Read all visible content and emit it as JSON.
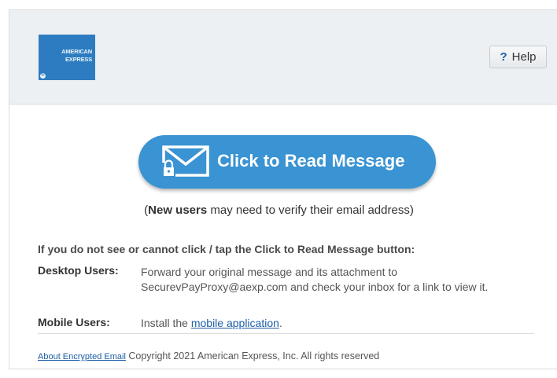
{
  "logo": {
    "line1": "AMERICAN",
    "line2": "EXPRESS",
    "registered": "®"
  },
  "header": {
    "help_icon": "?",
    "help_label": "Help"
  },
  "cta": {
    "label": "Click to Read Message",
    "icon": "envelope-lock-icon",
    "color": "#3a93d2"
  },
  "note": {
    "open": "(",
    "bold": "New users",
    "rest": " may need to verify their email address)"
  },
  "instructions": {
    "title": "If you do not see or cannot click / tap the Click to Read Message button:",
    "desktop_label": "Desktop Users:",
    "desktop_line1": "Forward your original message and its attachment to",
    "desktop_line2": "SecurevPayProxy@aexp.com and check your inbox for a link to view it.",
    "mobile_label": "Mobile Users:",
    "mobile_prefix": "Install the ",
    "mobile_link": "mobile application",
    "mobile_suffix": "."
  },
  "footer": {
    "link": "About Encrypted Email",
    "copyright": " Copyright 2021 American Express, Inc. All rights reserved"
  }
}
